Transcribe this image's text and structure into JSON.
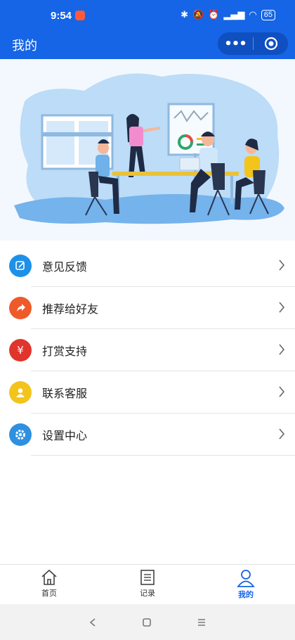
{
  "status": {
    "time": "9:54",
    "battery": "65"
  },
  "header": {
    "title": "我的",
    "more_glyph": "•••"
  },
  "menu": [
    {
      "label": "意见反馈",
      "icon": "edit-icon",
      "color": "#1e90e8"
    },
    {
      "label": "推荐给好友",
      "icon": "share-icon",
      "color": "#ef5a2a"
    },
    {
      "label": "打赏支持",
      "icon": "yuan-icon",
      "glyph": "¥",
      "color": "#e0342c"
    },
    {
      "label": "联系客服",
      "icon": "user-icon",
      "color": "#f2c41c"
    },
    {
      "label": "设置中心",
      "icon": "gear-icon",
      "color": "#2f8fe0"
    }
  ],
  "tabs": [
    {
      "label": "首页",
      "icon": "home-icon"
    },
    {
      "label": "记录",
      "icon": "document-icon"
    },
    {
      "label": "我的",
      "icon": "profile-icon",
      "active": true
    }
  ],
  "colors": {
    "primary": "#1565e6",
    "hero_bg": "#f3f8fe"
  }
}
